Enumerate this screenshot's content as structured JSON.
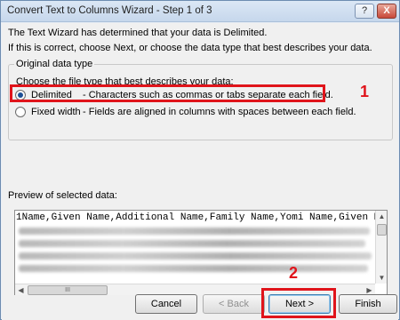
{
  "window": {
    "title": "Convert Text to Columns Wizard - Step 1 of 3",
    "help_label": "?",
    "close_label": "X"
  },
  "intro": {
    "line1": "The Text Wizard has determined that your data is Delimited.",
    "line2": "If this is correct, choose Next, or choose the data type that best describes your data."
  },
  "data_type_group": {
    "legend": "Original data type",
    "instruction": "Choose the file type that best describes your data:",
    "options": [
      {
        "label": "Delimited",
        "description": "- Characters such as commas or tabs separate each field.",
        "selected": true
      },
      {
        "label": "Fixed width",
        "description": "- Fields are aligned in columns with spaces between each field.",
        "selected": false
      }
    ]
  },
  "preview": {
    "label": "Preview of selected data:",
    "rows": [
      {
        "num": "1",
        "text": "Name,Given Name,Additional Name,Family Name,Yomi Name,Given Name"
      }
    ],
    "hscroll_thumb_label": "III"
  },
  "annotations": {
    "marker1": "1",
    "marker2": "2",
    "highlight_color": "#e0141b"
  },
  "buttons": {
    "cancel": "Cancel",
    "back": "< Back",
    "next": "Next >",
    "finish": "Finish"
  }
}
